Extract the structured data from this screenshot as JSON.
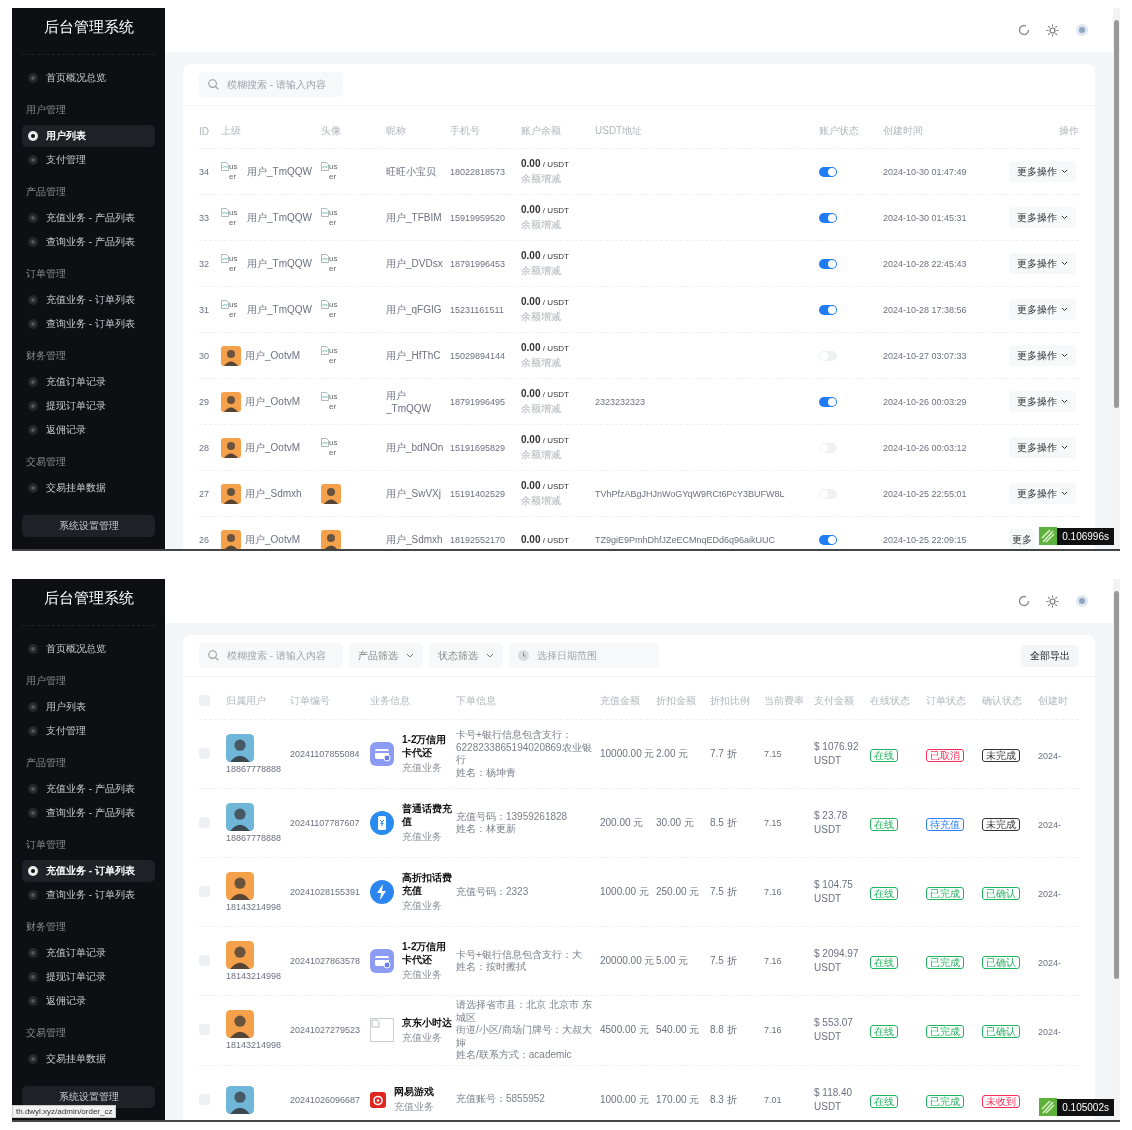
{
  "screens": [
    {
      "kind": "user_list",
      "sidebar": {
        "title": "后台管理系统",
        "groups": [
          {
            "items": [
              {
                "label": "首页概况总览",
                "selected": false
              }
            ]
          },
          {
            "heading": "用户管理",
            "items": [
              {
                "label": "用户列表",
                "selected": true
              },
              {
                "label": "支付管理",
                "selected": false
              }
            ]
          },
          {
            "heading": "产品管理",
            "items": [
              {
                "label": "充值业务 - 产品列表",
                "selected": false
              },
              {
                "label": "查询业务 - 产品列表",
                "selected": false
              }
            ]
          },
          {
            "heading": "订单管理",
            "items": [
              {
                "label": "充值业务 - 订单列表",
                "selected": false
              },
              {
                "label": "查询业务 - 订单列表",
                "selected": false
              }
            ]
          },
          {
            "heading": "财务管理",
            "items": [
              {
                "label": "充值订单记录",
                "selected": false
              },
              {
                "label": "提现订单记录",
                "selected": false
              },
              {
                "label": "返佣记录",
                "selected": false
              }
            ]
          },
          {
            "heading": "交易管理",
            "items": [
              {
                "label": "交易挂单数据",
                "selected": false
              }
            ]
          }
        ],
        "footer_button": "系统设置管理"
      },
      "search": {
        "placeholder": "模糊搜索 - 请输入内容"
      },
      "columns": [
        "ID",
        "上级",
        "头像",
        "昵称",
        "手机号",
        "账户余额",
        "USDT地址",
        "账户状态",
        "创建时间",
        "操作"
      ],
      "rows": [
        {
          "id": "34",
          "parent": {
            "avatar": {
              "kind": "broken",
              "alt": "user"
            },
            "name": "用户_TmQQW"
          },
          "avatar": {
            "kind": "broken",
            "alt": "user"
          },
          "nickname": "旺旺小宝贝",
          "phone": "18022818573",
          "balance": "0.00",
          "balance_unit": "/ USDT",
          "balance_action": "余额增减",
          "on": true,
          "created": "2024-10-30 01:47:49",
          "action": "更多操作",
          "caret": true
        },
        {
          "id": "33",
          "parent": {
            "avatar": {
              "kind": "broken",
              "alt": "user"
            },
            "name": "用户_TmQQW"
          },
          "avatar": {
            "kind": "broken",
            "alt": "user"
          },
          "nickname": "用户_TFBIM",
          "phone": "15919959520",
          "balance": "0.00",
          "balance_unit": "/ USDT",
          "balance_action": "余额增减",
          "on": true,
          "created": "2024-10-30 01:45:31",
          "action": "更多操作",
          "caret": true
        },
        {
          "id": "32",
          "parent": {
            "avatar": {
              "kind": "broken",
              "alt": "user"
            },
            "name": "用户_TmQQW"
          },
          "avatar": {
            "kind": "broken",
            "alt": "user"
          },
          "nickname": "用户_DVDsx",
          "phone": "18791996453",
          "balance": "0.00",
          "balance_unit": "/ USDT",
          "balance_action": "余额增减",
          "on": true,
          "created": "2024-10-28 22:45:43",
          "action": "更多操作",
          "caret": true
        },
        {
          "id": "31",
          "parent": {
            "avatar": {
              "kind": "broken",
              "alt": "user"
            },
            "name": "用户_TmQQW"
          },
          "avatar": {
            "kind": "broken",
            "alt": "user"
          },
          "nickname": "用户_qFGIG",
          "phone": "15231161511",
          "balance": "0.00",
          "balance_unit": "/ USDT",
          "balance_action": "余额增减",
          "on": true,
          "created": "2024-10-28 17:38:56",
          "action": "更多操作",
          "caret": true
        },
        {
          "id": "30",
          "parent": {
            "avatar": {
              "kind": "photo",
              "color": "#f5a04a"
            },
            "name": "用户_OotvM"
          },
          "avatar": {
            "kind": "broken",
            "alt": "user"
          },
          "nickname": "用户_HfThC",
          "phone": "15029894144",
          "balance": "0.00",
          "balance_unit": "/ USDT",
          "balance_action": "余额增减",
          "on": false,
          "created": "2024-10-27 03:07:33",
          "action": "更多操作",
          "caret": true
        },
        {
          "id": "29",
          "parent": {
            "avatar": {
              "kind": "photo",
              "color": "#f5a04a"
            },
            "name": "用户_OotvM"
          },
          "avatar": {
            "kind": "broken",
            "alt": "user"
          },
          "nickname": "用户_TmQQW",
          "phone": "18791996495",
          "balance": "0.00",
          "balance_unit": "/ USDT",
          "balance_action": "余额增减",
          "usdt_address": "2323232323",
          "on": true,
          "created": "2024-10-26 00:03:29",
          "action": "更多操作",
          "caret": true
        },
        {
          "id": "28",
          "parent": {
            "avatar": {
              "kind": "photo",
              "color": "#f5a04a"
            },
            "name": "用户_OotvM"
          },
          "avatar": {
            "kind": "broken",
            "alt": "user"
          },
          "nickname": "用户_bdNOn",
          "phone": "15191695829",
          "balance": "0.00",
          "balance_unit": "/ USDT",
          "balance_action": "余额增减",
          "on": false,
          "created": "2024-10-26 00:03:12",
          "action": "更多操作",
          "caret": true
        },
        {
          "id": "27",
          "parent": {
            "avatar": {
              "kind": "photo",
              "color": "#f5a04a"
            },
            "name": "用户_Sdmxh"
          },
          "avatar": {
            "kind": "photo",
            "color": "#f5a04a"
          },
          "nickname": "用户_SwVXj",
          "phone": "15191402529",
          "balance": "0.00",
          "balance_unit": "/ USDT",
          "balance_action": "余额增减",
          "usdt_address": "TVhPfzABgJHJnWoGYqW9RCt6PcY3BUFW8L",
          "on": false,
          "created": "2024-10-25 22:55:01",
          "action": "更多操作",
          "caret": true
        },
        {
          "id": "26",
          "parent": {
            "avatar": {
              "kind": "photo",
              "color": "#f5a04a"
            },
            "name": "用户_OotvM"
          },
          "avatar": {
            "kind": "photo",
            "color": "#f5a04a"
          },
          "nickname": "用户_Sdmxh",
          "phone": "18192552170",
          "balance": "0.00",
          "balance_unit": "/ USDT",
          "usdt_address": "TZ9giE9PmhDhfJZeECMnqEDd6q96aikUUC",
          "on": true,
          "created": "2024-10-25 22:09:15",
          "action": "更多",
          "caret": false
        }
      ],
      "timer_badge": "0.106996s"
    },
    {
      "kind": "order_list",
      "sidebar": {
        "title": "后台管理系统",
        "groups": [
          {
            "items": [
              {
                "label": "首页概况总览",
                "selected": false
              }
            ]
          },
          {
            "heading": "用户管理",
            "items": [
              {
                "label": "用户列表",
                "selected": false
              },
              {
                "label": "支付管理",
                "selected": false
              }
            ]
          },
          {
            "heading": "产品管理",
            "items": [
              {
                "label": "充值业务 - 产品列表",
                "selected": false
              },
              {
                "label": "查询业务 - 产品列表",
                "selected": false
              }
            ]
          },
          {
            "heading": "订单管理",
            "items": [
              {
                "label": "充值业务 - 订单列表",
                "selected": true
              },
              {
                "label": "查询业务 - 订单列表",
                "selected": false
              }
            ]
          },
          {
            "heading": "财务管理",
            "items": [
              {
                "label": "充值订单记录",
                "selected": false
              },
              {
                "label": "提现订单记录",
                "selected": false
              },
              {
                "label": "返佣记录",
                "selected": false
              }
            ]
          },
          {
            "heading": "交易管理",
            "items": [
              {
                "label": "交易挂单数据",
                "selected": false
              }
            ]
          }
        ],
        "footer_button": "系统设置管理"
      },
      "search": {
        "placeholder": "模糊搜索 - 请输入内容"
      },
      "filters": [
        "产品筛选",
        "状态筛选"
      ],
      "date_range": {
        "placeholder": "选择日期范围"
      },
      "export_button": "全部导出",
      "select_all": {
        "checked": false
      },
      "columns": [
        "归属用户",
        "订单编号",
        "业务信息",
        "下单信息",
        "充值金额",
        "折扣金额",
        "折扣比例",
        "当前费率",
        "支付金额",
        "在线状态",
        "订单状态",
        "确认状态",
        "创建时"
      ],
      "rows": [
        {
          "checked": false,
          "avatar": {
            "color": "#6fb6d8"
          },
          "phone": "18867778888",
          "order_no": "20241107855084",
          "service": {
            "kind": "card",
            "name": "1-2万信用卡代还",
            "type": "充值业务"
          },
          "info": [
            "卡号+银行信息包含支行：6228233865194020869农业银行",
            "姓名：杨坤青"
          ],
          "amount": "10000.00 元",
          "discount": "2.00 元",
          "ratio": "7.7 折",
          "rate": "7.15",
          "pay": "$ 1076.92 USDT",
          "online": {
            "label": "在线",
            "color": "#22b35e"
          },
          "order_status": {
            "label": "已取消",
            "color": "#f5315b"
          },
          "confirm": {
            "label": "未完成",
            "color": "#333333"
          },
          "created": "2024-"
        },
        {
          "checked": false,
          "avatar": {
            "color": "#6fb6d8"
          },
          "phone": "18867778888",
          "order_no": "20241107787607",
          "service": {
            "kind": "phone",
            "name": "普通话费充值",
            "type": "充值业务"
          },
          "info": [
            "充值号码：13959261828",
            "姓名：林更新"
          ],
          "amount": "200.00 元",
          "discount": "30.00 元",
          "ratio": "8.5 折",
          "rate": "7.15",
          "pay": "$ 23.78 USDT",
          "online": {
            "label": "在线",
            "color": "#22b35e"
          },
          "order_status": {
            "label": "待充值",
            "color": "#2f7ff5"
          },
          "confirm": {
            "label": "未完成",
            "color": "#333333"
          },
          "created": "2024-"
        },
        {
          "checked": false,
          "avatar": {
            "color": "#f5a04a"
          },
          "phone": "18143214998",
          "order_no": "20241028155391",
          "service": {
            "kind": "bolt",
            "name": "高折扣话费充值",
            "type": "充值业务"
          },
          "info": [
            "充值号码：2323"
          ],
          "amount": "1000.00 元",
          "discount": "250.00 元",
          "ratio": "7.5 折",
          "rate": "7.16",
          "pay": "$ 104.75 USDT",
          "online": {
            "label": "在线",
            "color": "#22b35e"
          },
          "order_status": {
            "label": "已完成",
            "color": "#22b35e"
          },
          "confirm": {
            "label": "已确认",
            "color": "#22b35e"
          },
          "created": "2024-"
        },
        {
          "checked": false,
          "avatar": {
            "color": "#f5a04a"
          },
          "phone": "18143214998",
          "order_no": "20241027863578",
          "service": {
            "kind": "card",
            "name": "1-2万信用卡代还",
            "type": "充值业务"
          },
          "info": [
            "卡号+银行信息包含支行：大",
            "姓名：按时擦拭"
          ],
          "amount": "20000.00 元",
          "discount": "5.00 元",
          "ratio": "7.5 折",
          "rate": "7.16",
          "pay": "$ 2094.97 USDT",
          "online": {
            "label": "在线",
            "color": "#22b35e"
          },
          "order_status": {
            "label": "已完成",
            "color": "#22b35e"
          },
          "confirm": {
            "label": "已确认",
            "color": "#22b35e"
          },
          "created": "2024-"
        },
        {
          "checked": false,
          "avatar": {
            "color": "#f5a04a"
          },
          "phone": "18143214998",
          "order_no": "20241027279523",
          "service": {
            "kind": "broken",
            "name": "京东小时达",
            "type": "充值业务"
          },
          "info": [
            "请选择省市县：北京 北京市 东城区",
            "街道/小区/商场门牌号：大叔大婶",
            "姓名/联系方式：academic"
          ],
          "amount": "4500.00 元",
          "discount": "540.00 元",
          "ratio": "8.8 折",
          "rate": "7.16",
          "pay": "$ 553.07 USDT",
          "online": {
            "label": "在线",
            "color": "#22b35e"
          },
          "order_status": {
            "label": "已完成",
            "color": "#22b35e"
          },
          "confirm": {
            "label": "已确认",
            "color": "#22b35e"
          },
          "created": "2024-"
        },
        {
          "checked": false,
          "avatar": {
            "color": "#6fb6d8"
          },
          "order_no": "20241026096687",
          "service": {
            "kind": "game",
            "name": "网易游戏",
            "type": "充值业务"
          },
          "info": [
            "充值账号：5855952"
          ],
          "amount": "1000.00 元",
          "discount": "170.00 元",
          "ratio": "8.3 折",
          "rate": "7.01",
          "pay": "$ 118.40 USDT",
          "online": {
            "label": "在线",
            "color": "#22b35e"
          },
          "order_status": {
            "label": "已完成",
            "color": "#22b35e"
          },
          "confirm": {
            "label": "未收到",
            "color": "#f5315b"
          }
        }
      ],
      "timer_badge": "0.105002s",
      "status_url": "th.dwyl.xyz/admin/order_cz"
    }
  ]
}
